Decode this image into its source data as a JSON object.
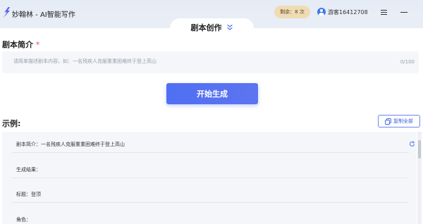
{
  "app": {
    "title": "妙翰林 - AI智能写作",
    "remaining": "剩余：8 次",
    "user": "游客16412708"
  },
  "tab": {
    "label": "剧本创作"
  },
  "intro": {
    "title": "剧本简介",
    "required_mark": "*",
    "placeholder": "请简单描述剧本内容，如：一名残疾人克服重重困难终于登上高山",
    "counter": "0/100"
  },
  "generate_button": "开始生成",
  "example": {
    "title": "示例:",
    "copy_all": "复制全部",
    "rows": [
      "剧本简介：一名残疾人克服重重困难终于登上高山",
      "生成结果：",
      "标题：登顶",
      "角色："
    ]
  },
  "colors": {
    "accent": "#4f6ff2",
    "required": "#e34d4d",
    "badge": "#f0dcb4"
  },
  "icons": [
    "app-logo-icon",
    "avatar-icon",
    "menu-icon",
    "minimize-icon",
    "chevron-down-icon",
    "copy-icon",
    "refresh-icon"
  ]
}
